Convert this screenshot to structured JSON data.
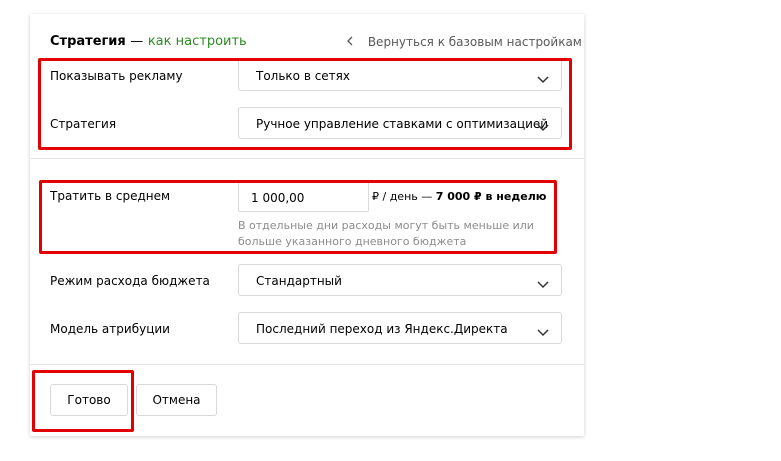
{
  "header": {
    "title": "Стратегия",
    "separator": "—",
    "help_link": "как настроить",
    "back_link": "Вернуться к базовым настройкам"
  },
  "show_ads": {
    "label": "Показывать рекламу",
    "value": "Только в сетях"
  },
  "strategy": {
    "label": "Стратегия",
    "value": "Ручное управление ставками с оптимизацией"
  },
  "budget": {
    "label": "Тратить в среднем",
    "value": "1 000,00",
    "unit": "₽ / день —",
    "weekly": "7 000 ₽ в неделю",
    "hint": "В отдельные дни расходы могут быть меньше или больше указанного дневного бюджета"
  },
  "budget_mode": {
    "label": "Режим расхода бюджета",
    "value": "Стандартный"
  },
  "attribution": {
    "label": "Модель атрибуции",
    "value": "Последний переход из Яндекс.Директа"
  },
  "actions": {
    "done_label": "Готово",
    "cancel_label": "Отмена"
  },
  "colors": {
    "highlight": "#e30000",
    "link_green": "#2e8b23",
    "hint_gray": "#8c8c8c"
  }
}
